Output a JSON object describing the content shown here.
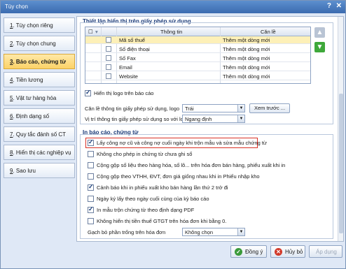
{
  "window": {
    "title": "Tùy chọn",
    "help": "?",
    "close": "✕"
  },
  "sidebar": {
    "items": [
      {
        "num": "1",
        "label": ". Tùy chọn riêng"
      },
      {
        "num": "2",
        "label": ". Tùy chọn chung"
      },
      {
        "num": "3",
        "label": ". Báo cáo, chứng từ"
      },
      {
        "num": "4",
        "label": ". Tiền lương"
      },
      {
        "num": "5",
        "label": ". Vật tư hàng hóa"
      },
      {
        "num": "6",
        "label": ". Định dạng số"
      },
      {
        "num": "7",
        "label": ". Quy tắc đánh số CT"
      },
      {
        "num": "8",
        "label": ". Hiển thị các nghiệp vụ"
      },
      {
        "num": "9",
        "label": ". Sao lưu"
      }
    ]
  },
  "license_section": {
    "title": "Thiết lập hiển thị trên giấy phép sử dụng",
    "grid": {
      "headers": {
        "info": "Thông tin",
        "align": "Căn lề"
      },
      "rows": [
        {
          "info": "Mã số thuế",
          "align": "Thêm một dòng mới"
        },
        {
          "info": "Số điện thoại",
          "align": "Thêm một dòng mới"
        },
        {
          "info": "Số Fax",
          "align": "Thêm một dòng mới"
        },
        {
          "info": "Email",
          "align": "Thêm một dòng mới"
        },
        {
          "info": "Website",
          "align": "Thêm một dòng mới"
        }
      ]
    },
    "show_logo": "Hiển thị logo trên báo cáo",
    "align_logo_label": "Căn lề thông tin giấy phép sử dụng, logo",
    "align_logo_value": "Trái",
    "browse_button": "Xem trước ...",
    "logo_position_label": "Vị trí thông tin giấy phép sử dụng so với logo",
    "logo_position_value": "Ngang định"
  },
  "print_section": {
    "title": "In báo cáo, chứng từ",
    "options": [
      {
        "label": "Lấy công nợ cũ và công nợ cuối ngày khi trộn mẫu và sửa mẫu chứng từ",
        "checked": true
      },
      {
        "label": "Không cho phép in chứng từ chưa ghi sổ",
        "checked": false
      },
      {
        "label": "Cộng gộp số liệu theo hàng hóa, số lô... trên hóa đơn bán hàng, phiếu xuất khi in",
        "checked": false
      },
      {
        "label": "Cộng gộp theo VTHH, ĐVT, đơn giá giống nhau khi in Phiếu nhập kho",
        "checked": false
      },
      {
        "label": "Cảnh báo khi in phiếu xuất kho bán hàng lần thứ 2 trở đi",
        "checked": true
      },
      {
        "label": "Ngày ký lấy theo ngày cuối cùng của kỳ báo cáo",
        "checked": false
      },
      {
        "label": "In mẫu trộn chứng từ theo định dạng PDF",
        "checked": true
      },
      {
        "label": "Không hiển thị tiền thuế GTGT trên hóa đơn khi bằng 0.",
        "checked": false
      }
    ],
    "separator_label": "Gạch bỏ phần trống trên hóa đơn",
    "separator_value": "Không chọn"
  },
  "footer": {
    "ok": "Đồng ý",
    "cancel": "Hủy bỏ",
    "apply": "Áp dụng"
  },
  "colors": {
    "accent": "#3b6bb0",
    "highlight": "#d93025",
    "selected_nav": "#fcd267"
  }
}
